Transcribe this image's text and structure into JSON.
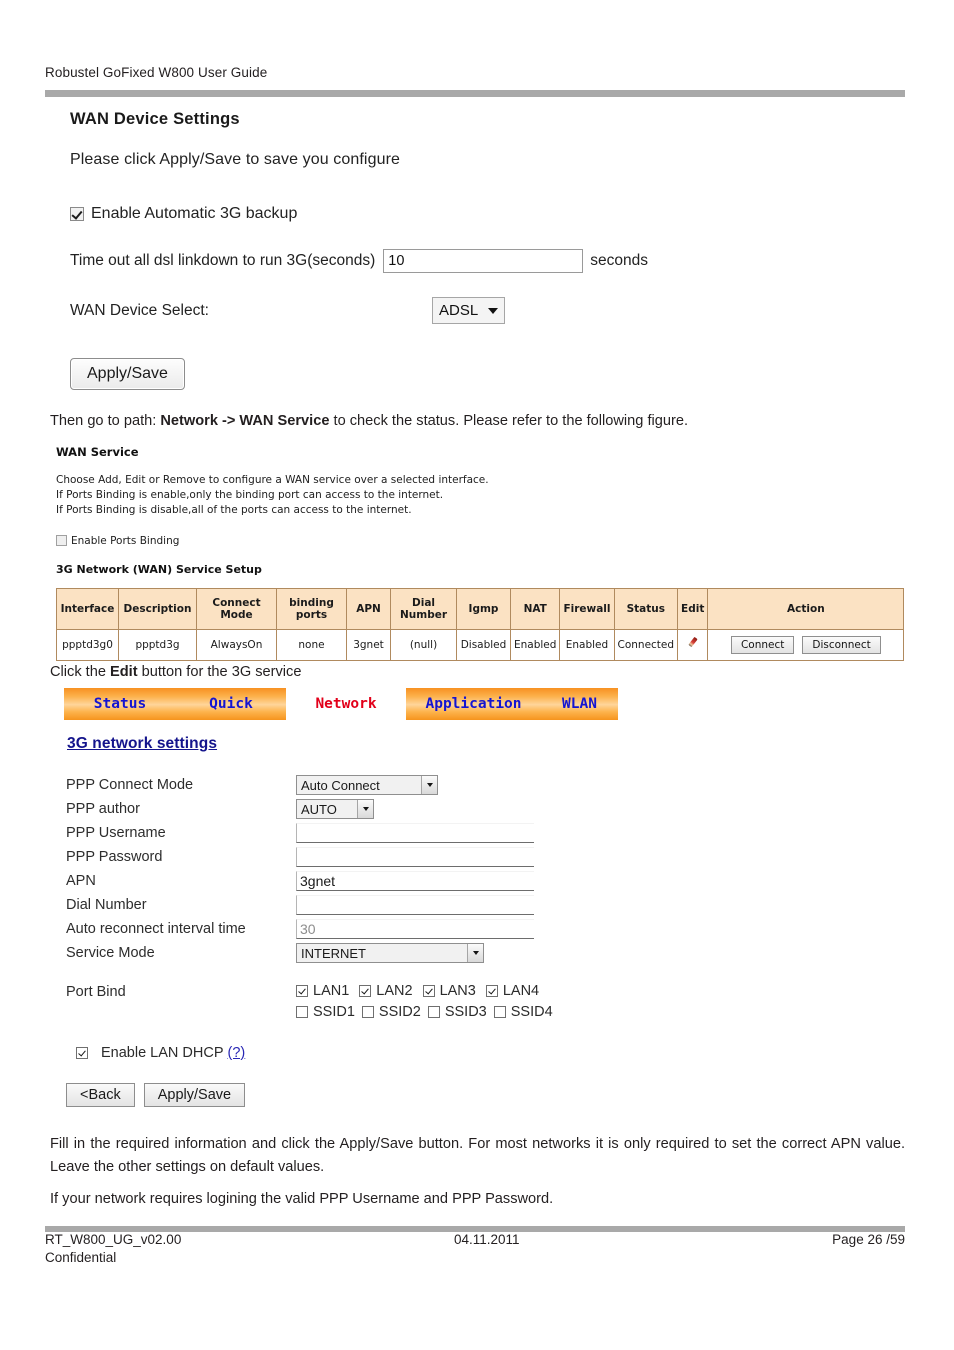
{
  "doc": {
    "header": "Robustel GoFixed W800 User Guide",
    "footer": {
      "left": "RT_W800_UG_v02.00",
      "center": "04.11.2011",
      "right": "Page 26 /59",
      "confidential": "Confidential"
    }
  },
  "wan_device_settings": {
    "title": "WAN Device Settings",
    "subtitle": "Please click Apply/Save to save you configure",
    "enable_backup_label": "Enable Automatic 3G backup",
    "enable_backup_checked": true,
    "timeout_label": "Time out all dsl linkdown to run 3G(seconds)",
    "timeout_value": "10",
    "timeout_suffix": "seconds",
    "device_select_label": "WAN Device Select:",
    "device_select_value": "ADSL",
    "apply_label": "Apply/Save"
  },
  "paragraphs": {
    "then_go_pre": "Then go to path: ",
    "then_go_bold": "Network -> WAN Service",
    "then_go_post": " to check the status. Please refer to the following figure.",
    "click_edit_pre": "Click the ",
    "click_edit_bold": "Edit",
    "click_edit_post": " button for the 3G service",
    "fill_in": "Fill in the required information and click the Apply/Save button. For most networks it is only required to set the correct APN value. Leave the other settings on default values.",
    "if_network": "If your network requires logining the valid PPP Username and PPP Password."
  },
  "wan_service": {
    "title": "WAN Service",
    "desc_line1": "Choose Add, Edit or Remove to configure a WAN service over a selected interface.",
    "desc_line2": "If Ports Binding is enable,only the binding port can access to the internet.",
    "desc_line3": "If Ports Binding is disable,all of the ports can access to the internet.",
    "enable_ports_binding_label": "Enable Ports Binding",
    "enable_ports_binding_checked": false,
    "setup_title": "3G Network (WAN) Service Setup",
    "table": {
      "columns": [
        "Interface",
        "Description",
        "Connect Mode",
        "binding ports",
        "APN",
        "Dial Number",
        "Igmp",
        "NAT",
        "Firewall",
        "Status",
        "Edit",
        "Action"
      ],
      "rows": [
        {
          "interface": "ppptd3g0",
          "description": "ppptd3g",
          "connect_mode": "AlwaysOn",
          "binding_ports": "none",
          "apn": "3gnet",
          "dial_number": "(null)",
          "igmp": "Disabled",
          "nat": "Enabled",
          "firewall": "Enabled",
          "status": "Connected",
          "edit_icon": "pencil-icon",
          "action_connect": "Connect",
          "action_disconnect": "Disconnect"
        }
      ]
    }
  },
  "router_ui": {
    "nav_tabs": [
      {
        "label": "Status",
        "active": false
      },
      {
        "label": "Quick",
        "active": false
      },
      {
        "label": "Network",
        "active": true
      },
      {
        "label": "Application",
        "active": false
      },
      {
        "label": "WLAN",
        "active": false
      }
    ],
    "heading": "3G network settings",
    "fields": {
      "ppp_connect_mode_label": "PPP Connect Mode",
      "ppp_connect_mode_value": "Auto Connect",
      "ppp_author_label": "PPP author",
      "ppp_author_value": "AUTO",
      "ppp_username_label": "PPP Username",
      "ppp_username_value": "",
      "ppp_password_label": "PPP Password",
      "ppp_password_value": "",
      "apn_label": "APN",
      "apn_value": "3gnet",
      "dial_number_label": "Dial Number",
      "dial_number_value": "",
      "auto_reconnect_label": "Auto reconnect interval time",
      "auto_reconnect_value": "30",
      "service_mode_label": "Service Mode",
      "service_mode_value": "INTERNET"
    },
    "port_bind": {
      "label": "Port Bind",
      "lan": [
        {
          "label": "LAN1",
          "checked": true
        },
        {
          "label": "LAN2",
          "checked": true
        },
        {
          "label": "LAN3",
          "checked": true
        },
        {
          "label": "LAN4",
          "checked": true
        }
      ],
      "ssid": [
        {
          "label": "SSID1",
          "checked": false
        },
        {
          "label": "SSID2",
          "checked": false
        },
        {
          "label": "SSID3",
          "checked": false
        },
        {
          "label": "SSID4",
          "checked": false
        }
      ]
    },
    "dhcp": {
      "label": "Enable LAN DHCP",
      "help": "(?)",
      "checked": true
    },
    "buttons": {
      "back": "<Back",
      "apply_save": "Apply/Save"
    }
  },
  "colors": {
    "nav_orange": "#f79121",
    "nav_link_blue": "#1414d2",
    "nav_active_red": "#e2001a",
    "table_header_peach": "#fbe2c3",
    "table_border_brown": "#b08a5e",
    "heading_blue": "#14148c",
    "rule_gray": "#a9a9a9"
  }
}
